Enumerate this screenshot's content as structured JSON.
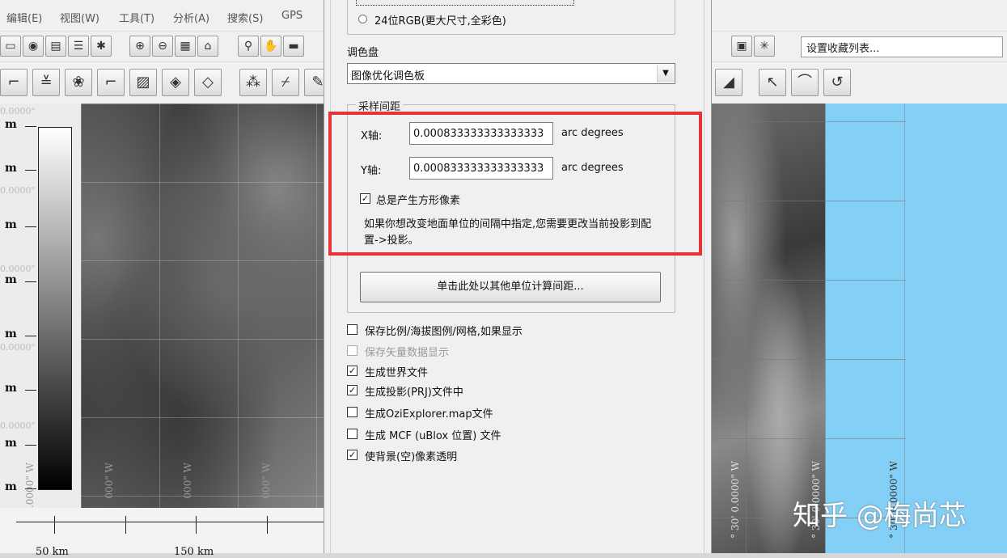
{
  "menubar": {
    "items": [
      "编辑(E)",
      "视图(W)",
      "工具(T)",
      "分析(A)",
      "搜索(S)",
      "GPS"
    ]
  },
  "toolbar": {
    "favorites_value": "设置收藏列表..."
  },
  "map_left": {
    "legend_units": [
      "m",
      "m",
      "m",
      "m",
      "m",
      "m",
      "m",
      "m"
    ],
    "coord_labels": [
      "0.0000\"",
      "0.0000\"",
      "0.0000\"",
      "0.0000\"",
      "0.0000\""
    ],
    "scale_labels": [
      "50 km",
      "150 km"
    ],
    "bottom_coords": [
      "0.0000\" W",
      "000\" W",
      "000\" W",
      "000\" W"
    ]
  },
  "map_right": {
    "bottom_coords": [
      "° 30' 0.0000\" W",
      "° 30' 0.0000\" W",
      "° 30' 0.0000\" W"
    ],
    "watermark": "知乎 @梅尚芯"
  },
  "dialog": {
    "color_option_label": "24位RGB(更大尺寸,全彩色)",
    "palette_label": "调色盘",
    "palette_value": "图像优化调色板",
    "sampling_legend": "采样间距",
    "x_label": "X轴:",
    "x_value": "0.000833333333333333",
    "x_unit": "arc degrees",
    "y_label": "Y轴:",
    "y_value": "0.000833333333333333",
    "y_unit": "arc degrees",
    "square_pixels_label": "总是产生方形像素",
    "square_pixels_checked": true,
    "info_text": "如果你想改变地面单位的间隔中指定,您需要更改当前投影到配置->投影。",
    "calc_button": "单击此处以其他单位计算间距...",
    "options": [
      {
        "label": "保存比例/海拔图例/网格,如果显示",
        "checked": false,
        "enabled": true
      },
      {
        "label": "保存矢量数据显示",
        "checked": false,
        "enabled": false
      },
      {
        "label": "生成世界文件",
        "checked": true,
        "enabled": true
      },
      {
        "label": "生成投影(PRJ)文件中",
        "checked": true,
        "enabled": true
      },
      {
        "label": "生成OziExplorer.map文件",
        "checked": false,
        "enabled": true
      },
      {
        "label": "生成 MCF (uBlox 位置) 文件",
        "checked": false,
        "enabled": true
      },
      {
        "label": "使背景(空)像素透明",
        "checked": true,
        "enabled": true
      }
    ]
  },
  "colors": {
    "highlight": "#e5333a",
    "sea": "#84cff6",
    "dialog_bg": "#f0f0f0"
  }
}
